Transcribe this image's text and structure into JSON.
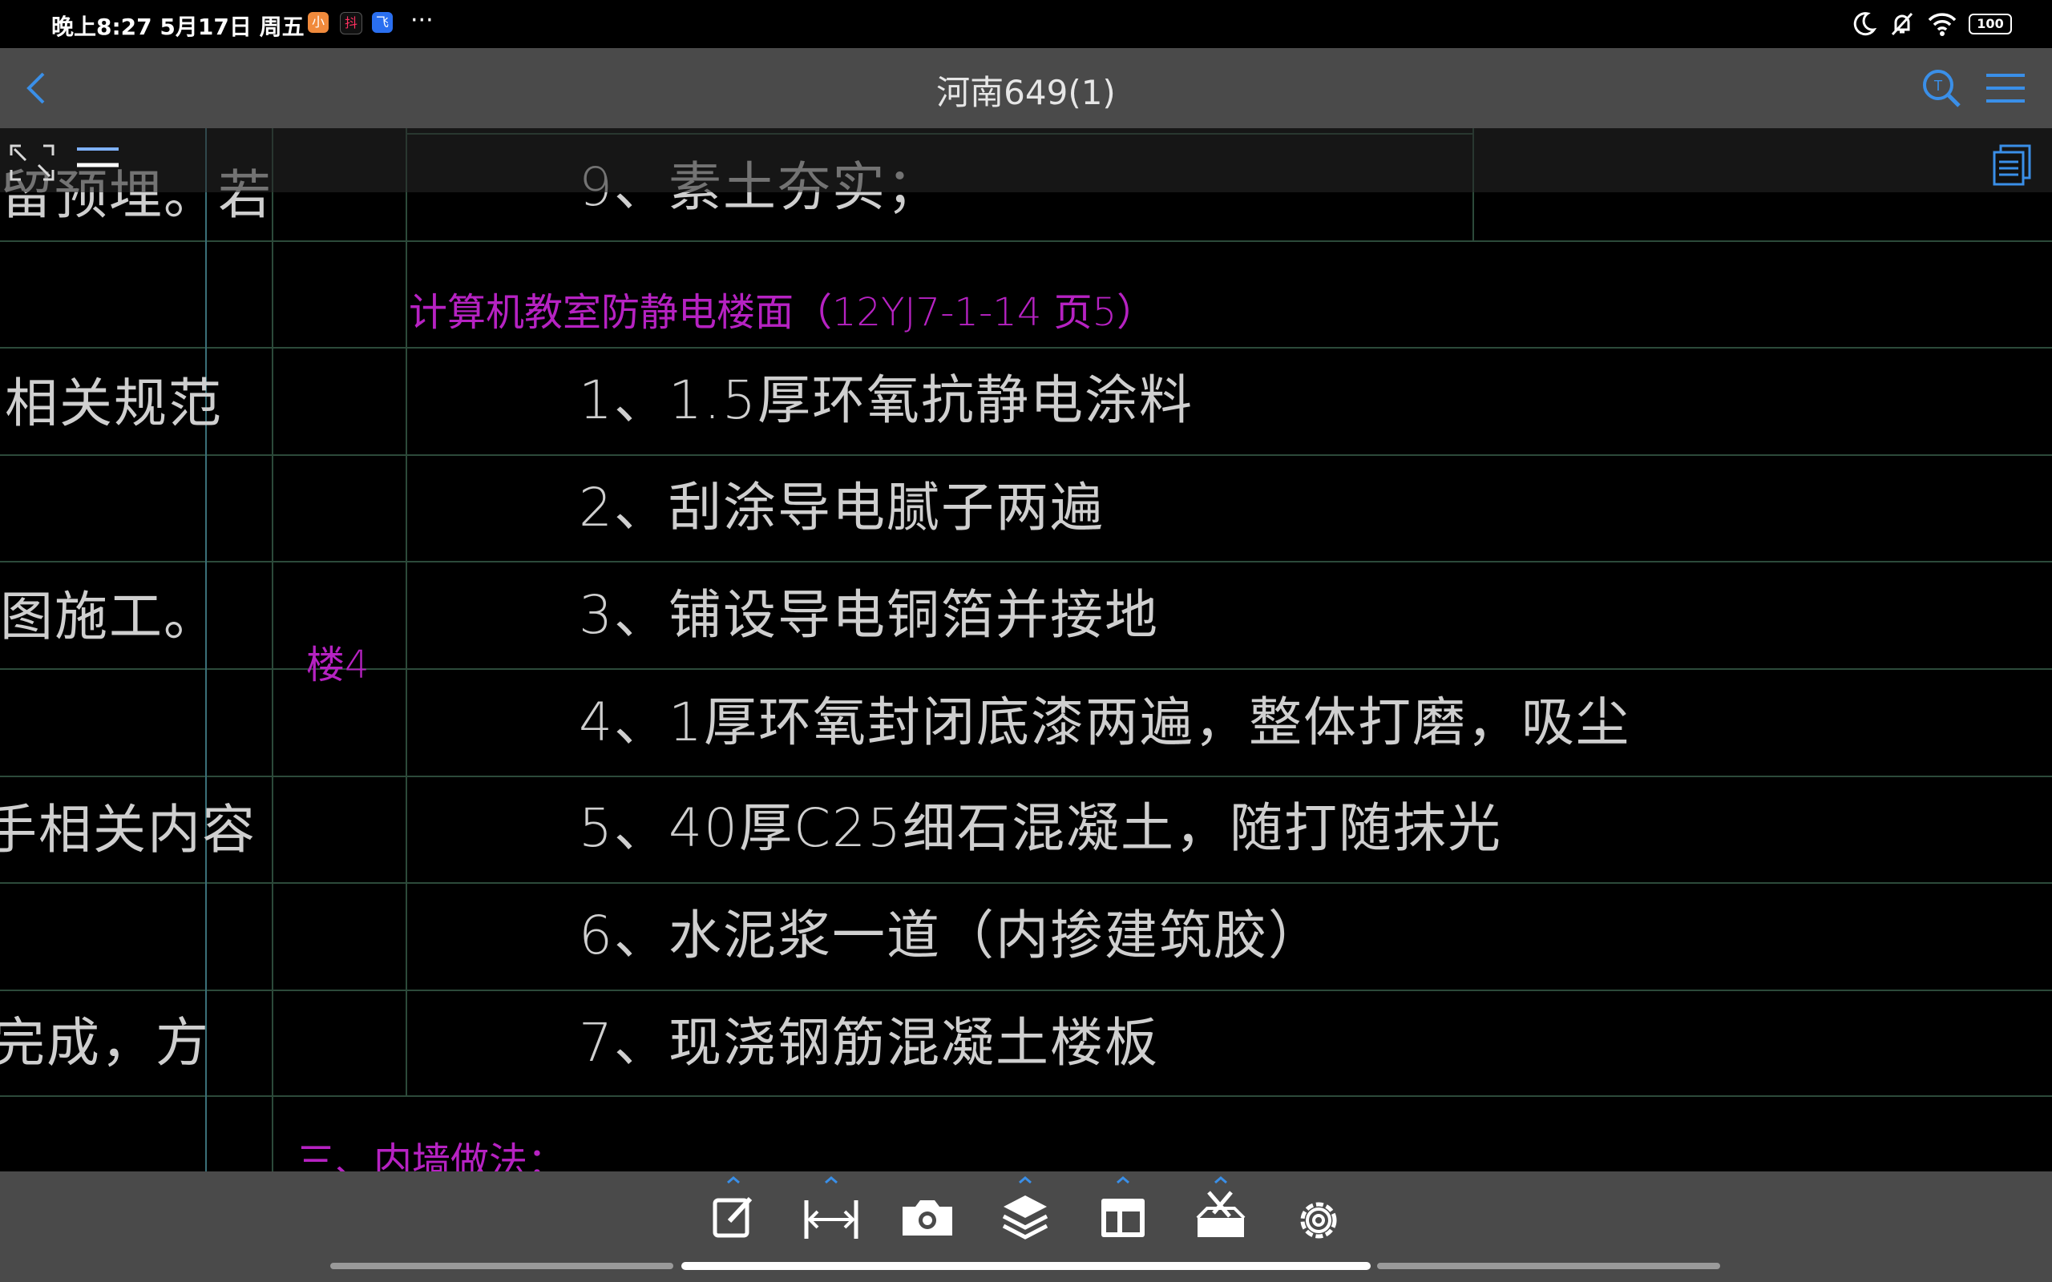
{
  "status": {
    "time": "晚上8:27 5月17日 周五",
    "dots": "···",
    "battery": "100",
    "app_badges": [
      "小",
      "抖",
      "飞"
    ]
  },
  "titlebar": {
    "title": "河南649(1)"
  },
  "drawing": {
    "left_fragments": [
      "留预埋。若",
      "相关规范",
      "图施工。",
      "手相关内容",
      "完成，方"
    ],
    "row_label": "楼4",
    "section_title": "计算机教室防静电楼面（12YJ7-1-14 页5）",
    "top_item": "9、素土夯实；",
    "items": [
      "1、1.5厚环氧抗静电涂料",
      "2、刮涂导电腻子两遍",
      "3、铺设导电铜箔并接地",
      "4、1厚环氧封闭底漆两遍，整体打磨，吸尘",
      "5、40厚C25细石混凝土，随打随抹光",
      "6、水泥浆一道（内掺建筑胶）",
      "7、现浇钢筋混凝土楼板"
    ],
    "next_section": "三、内墙做法："
  },
  "colors": {
    "titlebar_bg": "#4a4a4a",
    "accent_blue": "#3a8fe8",
    "cad_text": "#cfcfcf",
    "cad_magenta": "#b622c2"
  },
  "toolbar": {
    "icons": [
      "edit-icon",
      "measure-icon",
      "camera-icon",
      "layers-icon",
      "layout-icon",
      "toolbox-icon",
      "settings-icon"
    ]
  }
}
